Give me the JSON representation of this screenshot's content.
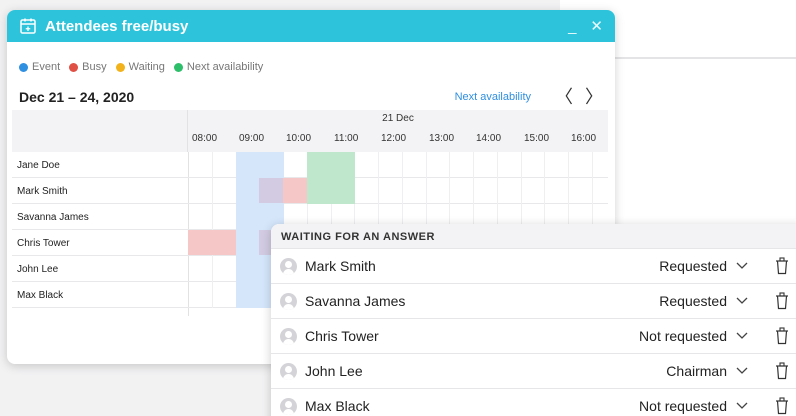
{
  "dialog": {
    "title": "Attendees free/busy",
    "minimize_symbol": "_",
    "close_symbol": "✕",
    "legend": [
      {
        "label": "Event",
        "color": "#2f8fe0"
      },
      {
        "label": "Busy",
        "color": "#e05045"
      },
      {
        "label": "Waiting",
        "color": "#f2b21b"
      },
      {
        "label": "Next availability",
        "color": "#2dbf6a"
      }
    ],
    "date_range": "Dec 21 – 24, 2020",
    "next_availability_label": "Next availability",
    "prev_symbol": "〈",
    "next_symbol": "〉",
    "day_label": "21 Dec",
    "hours": [
      "08:00",
      "09:00",
      "10:00",
      "11:00",
      "12:00",
      "13:00",
      "14:00",
      "15:00",
      "16:00"
    ],
    "attendees": [
      "Jane Doe",
      "Mark Smith",
      "Savanna James",
      "Chris Tower",
      "John Lee",
      "Max Black"
    ]
  },
  "schedule": {
    "event": {
      "start_hour": 9.0,
      "end_hour": 10.0,
      "color": "#d5e6fb"
    },
    "next_availability": {
      "start_hour": 10.5,
      "end_hour": 11.5,
      "color": "#bfe7cc"
    },
    "busy": [
      {
        "attendee": "Mark Smith",
        "start_hour": 9.5,
        "end_hour": 10.5,
        "color": "#f5c7c7",
        "overlap_color": "#d2cbe2"
      },
      {
        "attendee": "Chris Tower",
        "start_hour": 8.0,
        "end_hour": 9.0,
        "color": "#f5c7c7"
      },
      {
        "attendee": "Chris Tower",
        "start_hour": 9.5,
        "end_hour": 10.0,
        "color": "#f5c7c7",
        "overlap_color": "#d2cbe2"
      }
    ]
  },
  "waiting": {
    "title": "WAITING FOR AN ANSWER",
    "rows": [
      {
        "name": "Mark Smith",
        "status": "Requested"
      },
      {
        "name": "Savanna James",
        "status": "Requested"
      },
      {
        "name": "Chris Tower",
        "status": "Not requested"
      },
      {
        "name": "John Lee",
        "status": "Chairman"
      },
      {
        "name": "Max Black",
        "status": "Not requested"
      }
    ]
  }
}
